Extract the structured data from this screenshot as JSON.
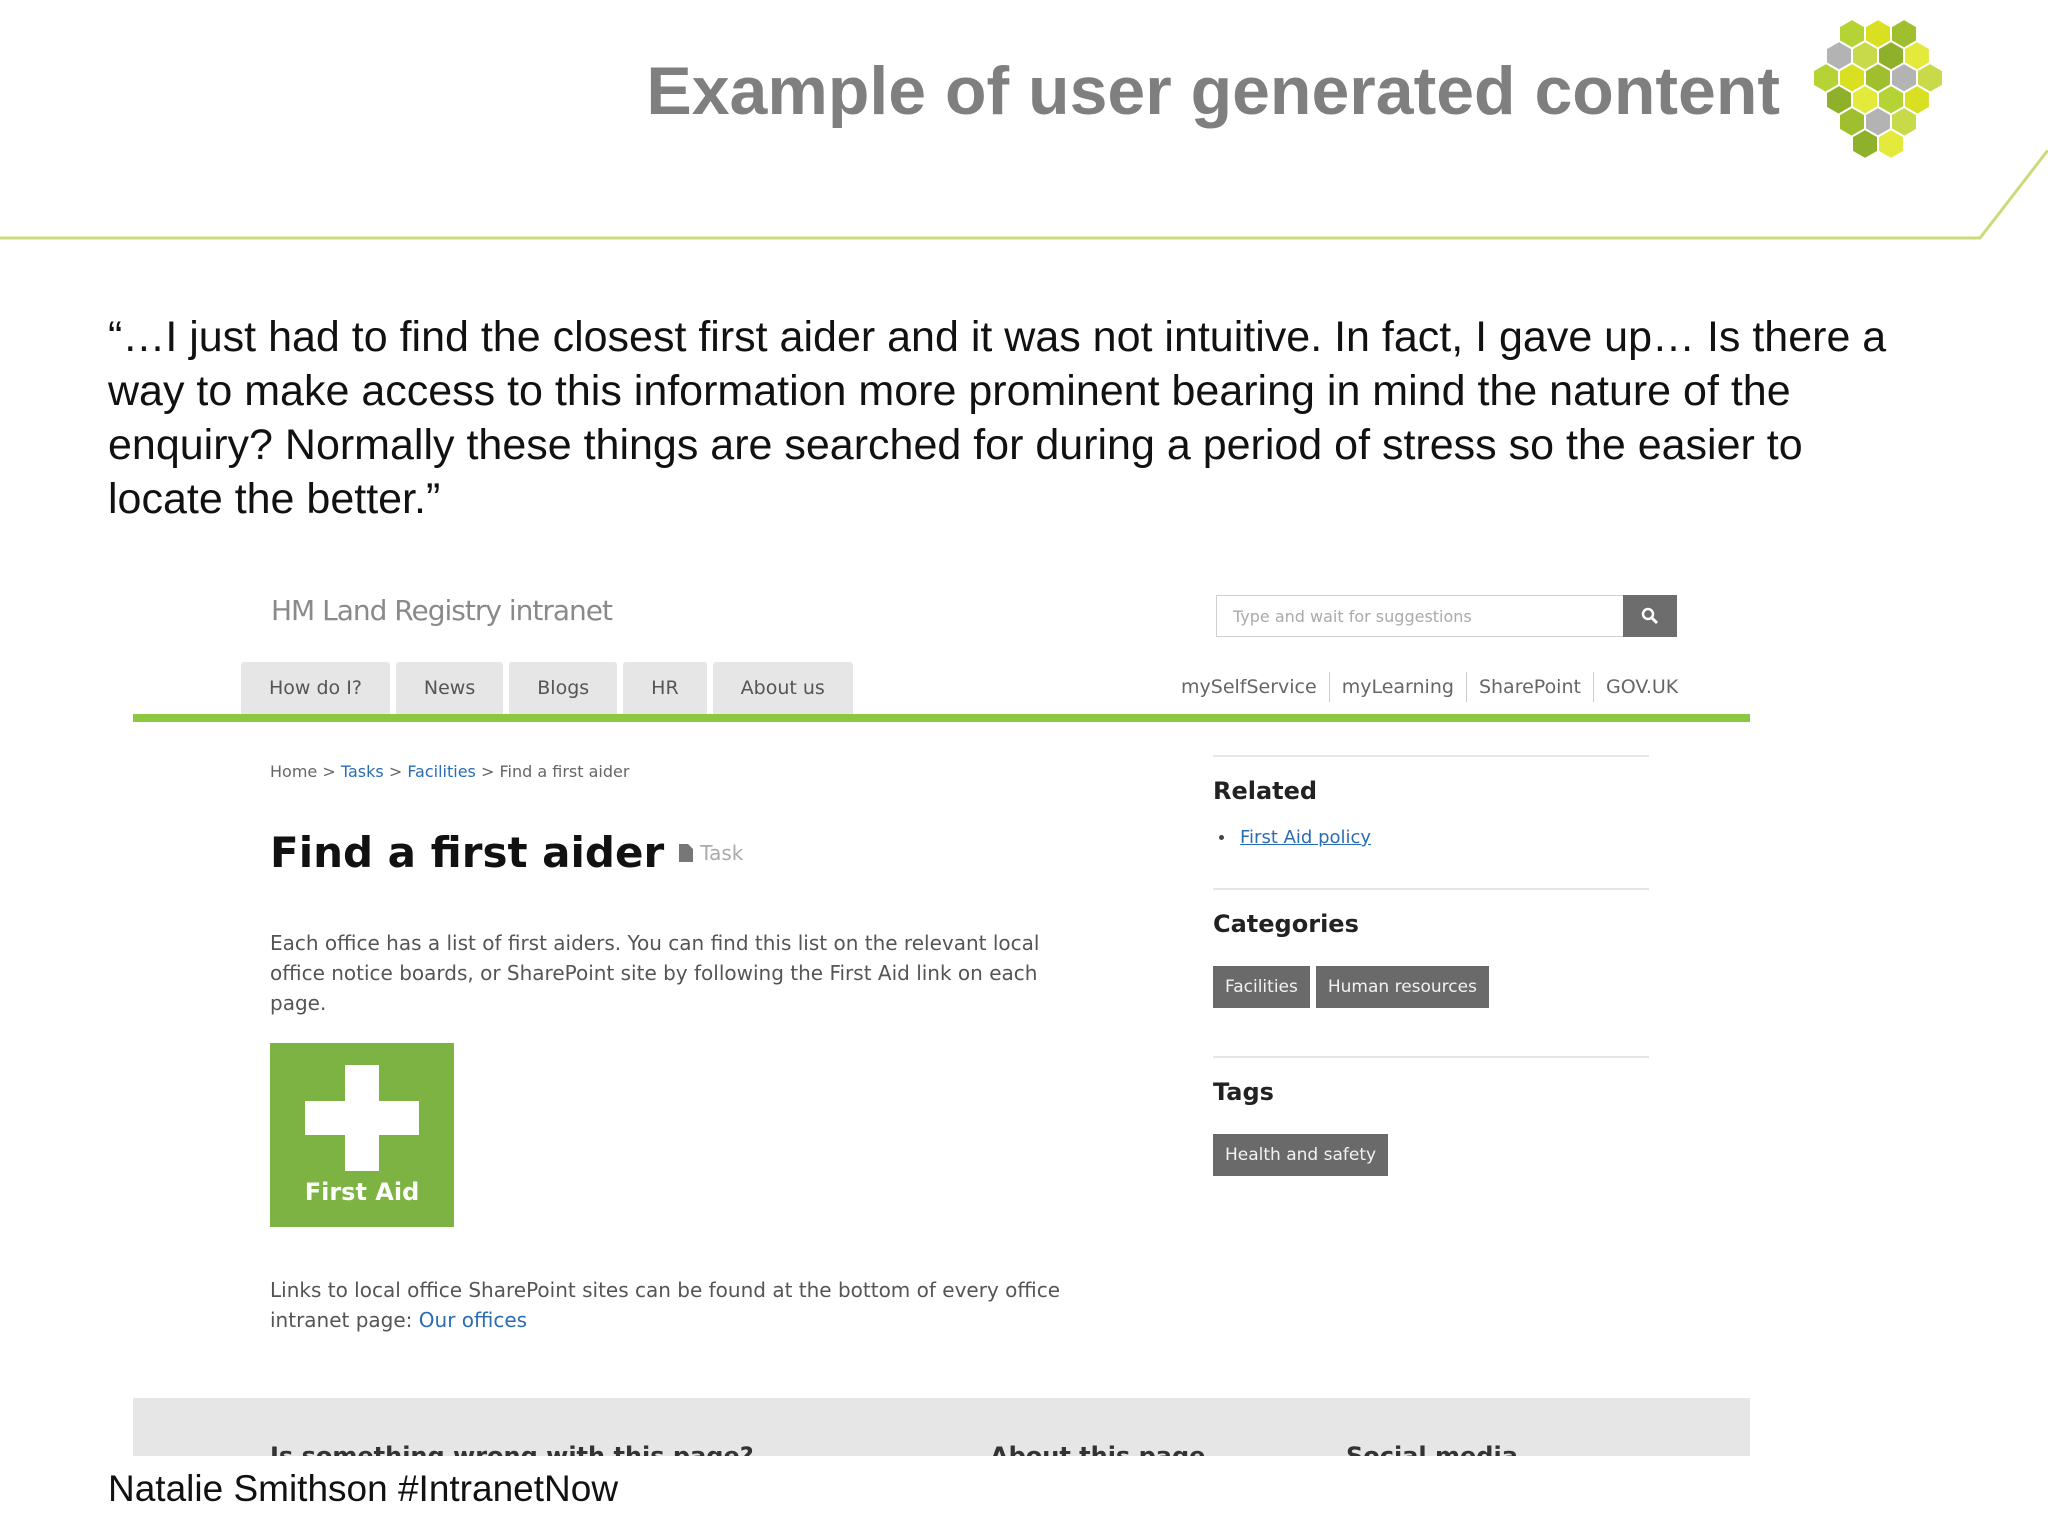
{
  "slide": {
    "title": "Example of user generated content",
    "quote": "“…I just had to find the closest first aider and it was not intuitive.  In fact, I gave up… Is there a way to make access to this information more prominent bearing in mind the nature of the enquiry? Normally these things are searched for during a period of stress so the easier to locate the better.”",
    "credit": "Natalie Smithson #IntranetNow",
    "accent_color": "#b5d334",
    "logo_icon": "hexagon-cluster-logo"
  },
  "intranet": {
    "brand": "HM Land Registry intranet",
    "search": {
      "placeholder": "Type and wait for suggestions",
      "icon": "search-icon"
    },
    "nav": [
      "How do I?",
      "News",
      "Blogs",
      "HR",
      "About us"
    ],
    "service_links": [
      "mySelfService",
      "myLearning",
      "SharePoint",
      "GOV.UK"
    ],
    "breadcrumb": {
      "home": "Home",
      "sep": ">",
      "tasks": "Tasks",
      "facilities": "Facilities",
      "current": "Find a first aider"
    },
    "page_title": "Find a first aider",
    "page_type": "Task",
    "body_1": "Each office has a list of first aiders. You can find this list on the relevant local office notice boards, or SharePoint site by following the First Aid link on each page.",
    "first_aid_tile": "First Aid",
    "body_2_prefix": "Links to local office SharePoint sites can be found at the bottom of every office intranet page: ",
    "body_2_link": "Our offices",
    "sidebar": {
      "related_heading": "Related",
      "related_items": [
        "First Aid policy"
      ],
      "categories_heading": "Categories",
      "categories": [
        "Facilities",
        "Human resources"
      ],
      "tags_heading": "Tags",
      "tags": [
        "Health and safety"
      ]
    },
    "footer": {
      "col1": "Is something wrong with this page?",
      "col2": "About this page",
      "col3": "Social media"
    },
    "colors": {
      "nav_green": "#8dc63f",
      "link_blue": "#2a6db5",
      "chip_gray": "#6a6a6a"
    }
  }
}
